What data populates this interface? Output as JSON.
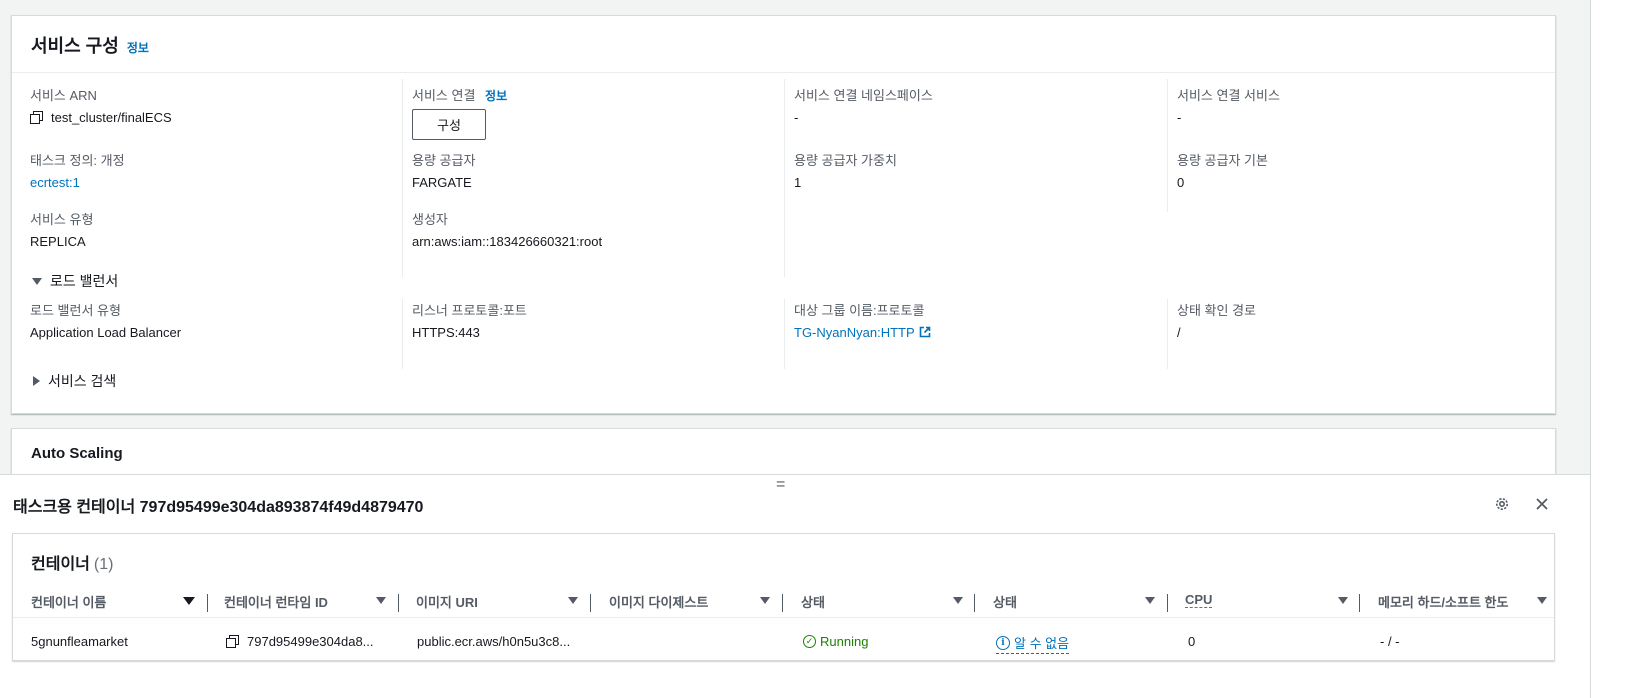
{
  "service_config": {
    "title": "서비스 구성",
    "info_label": "정보",
    "fields": {
      "service_arn": {
        "label": "서비스 ARN",
        "value": "test_cluster/finalECS"
      },
      "service_connect": {
        "label": "서비스 연결",
        "info_label": "정보",
        "button_label": "구성"
      },
      "service_connect_namespace": {
        "label": "서비스 연결 네임스페이스",
        "value": "-"
      },
      "service_connect_service": {
        "label": "서비스 연결 서비스",
        "value": "-"
      },
      "task_definition": {
        "label": "태스크 정의: 개정",
        "value": "ecrtest:1"
      },
      "capacity_provider": {
        "label": "용량 공급자",
        "value": "FARGATE"
      },
      "capacity_provider_weight": {
        "label": "용량 공급자 가중치",
        "value": "1"
      },
      "capacity_provider_base": {
        "label": "용량 공급자 기본",
        "value": "0"
      },
      "service_type": {
        "label": "서비스 유형",
        "value": "REPLICA"
      },
      "created_by": {
        "label": "생성자",
        "value": "arn:aws:iam::183426660321:root"
      }
    },
    "load_balancer": {
      "section_label": "로드 밸런서",
      "type": {
        "label": "로드 밸런서 유형",
        "value": "Application Load Balancer"
      },
      "listener": {
        "label": "리스너 프로토콜:포트",
        "value": "HTTPS:443"
      },
      "target_group": {
        "label": "대상 그룹 이름:프로토콜",
        "value": "TG-NyanNyan:HTTP"
      },
      "health_check": {
        "label": "상태 확인 경로",
        "value": "/"
      }
    },
    "service_discovery_label": "서비스 검색"
  },
  "auto_scaling": {
    "title": "Auto Scaling"
  },
  "split_panel": {
    "drag_handle": "=",
    "title": "태스크용 컨테이너 797d95499e304da893874f49d4879470",
    "settings_icon": "gear-icon",
    "close_icon": "close-icon"
  },
  "containers_table": {
    "title": "컨테이너",
    "count": "(1)",
    "columns": [
      "컨테이너 이름",
      "컨테이너 런타임 ID",
      "이미지 URI",
      "이미지 다이제스트",
      "상태",
      "상태",
      "CPU",
      "메모리 하드/소프트 한도"
    ],
    "rows": [
      {
        "name": "5gnunfleamarket",
        "runtime_id": "797d95499e304da8...",
        "image_uri": "public.ecr.aws/h0n5u3c8...",
        "image_digest": "",
        "status": "Running",
        "health": "알 수 없음",
        "cpu": "0",
        "memory": "- / -"
      }
    ]
  },
  "colors": {
    "link": "#0073bb",
    "running": "#1d8102",
    "background": "#f2f3f3"
  }
}
